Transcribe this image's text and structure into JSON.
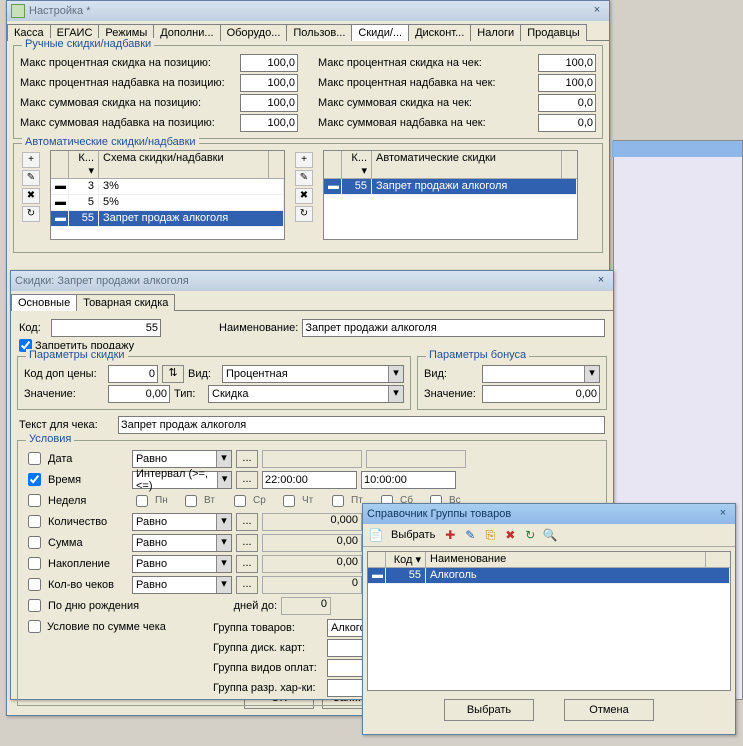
{
  "bg": {},
  "win1": {
    "title": "Настройка *",
    "tabs": [
      "Касса",
      "ЕГАИС",
      "Режимы",
      "Дополни...",
      "Оборудо...",
      "Пользов...",
      "Скиди/...",
      "Дисконт...",
      "Налоги",
      "Продавцы"
    ],
    "active_tab": 6,
    "g1": {
      "legend": "Ручные скидки/надбавки",
      "rows_left": [
        {
          "lbl": "Макс процентная скидка на позицию:",
          "val": "100,0"
        },
        {
          "lbl": "Макс процентная надбавка на позицию:",
          "val": "100,0"
        },
        {
          "lbl": "Макс суммовая скидка на позицию:",
          "val": "100,0"
        },
        {
          "lbl": "Макс суммовая надбавка на позицию:",
          "val": "100,0"
        }
      ],
      "rows_right": [
        {
          "lbl": "Макс процентная скидка на чек:",
          "val": "100,0"
        },
        {
          "lbl": "Макс процентная надбавка на чек:",
          "val": "100,0"
        },
        {
          "lbl": "Макс суммовая скидка на чек:",
          "val": "0,0"
        },
        {
          "lbl": "Макс суммовая надбавка на чек:",
          "val": "0,0"
        }
      ]
    },
    "g2": {
      "legend": "Автоматические скидки/надбавки",
      "left": {
        "head": [
          "",
          "К...",
          "Схема скидки/надбавки"
        ],
        "rows": [
          {
            "k": "3",
            "name": "3%"
          },
          {
            "k": "5",
            "name": "5%"
          },
          {
            "k": "55",
            "name": "Запрет продаж алкоголя"
          }
        ],
        "sel": 2
      },
      "right": {
        "head": [
          "",
          "К...",
          "Автоматические скидки"
        ],
        "rows": [
          {
            "k": "55",
            "name": "Запрет продажи алкоголя"
          }
        ],
        "sel": 0
      }
    },
    "buttons": {
      "ok": "OK",
      "save": "Зап..."
    }
  },
  "win2": {
    "title": "Скидки: Запрет продажи алкоголя",
    "tabs": [
      "Основные",
      "Товарная скидка"
    ],
    "active_tab": 0,
    "code_lbl": "Код:",
    "code": "55",
    "name_lbl": "Наименование:",
    "name": "Запрет продажи алкоголя",
    "forbid": "Запретить продажу",
    "forbid_checked": true,
    "p_skidka": {
      "legend": "Параметры скидки",
      "dopcode_lbl": "Код доп цены:",
      "dopcode": "0",
      "vid_lbl": "Вид:",
      "vid": "Процентная",
      "val_lbl": "Значение:",
      "val": "0,00",
      "tip_lbl": "Тип:",
      "tip": "Скидка"
    },
    "p_bonus": {
      "legend": "Параметры бонуса",
      "vid_lbl": "Вид:",
      "vid": "",
      "val_lbl": "Значение:",
      "val": "0,00"
    },
    "textchek_lbl": "Текст для чека:",
    "textchek": "Запрет продаж алкоголя",
    "cond": {
      "legend": "Условия",
      "rows": [
        {
          "cb": false,
          "lbl": "Дата",
          "op": "Равно"
        },
        {
          "cb": true,
          "lbl": "Время",
          "op": "Интервал (>=,<=)",
          "v1": "22:00:00",
          "v2": "10:00:00"
        },
        {
          "cb": false,
          "lbl": "Неделя",
          "days": [
            "Пн",
            "Вт",
            "Ср",
            "Чт",
            "Пт",
            "Сб",
            "Вс"
          ]
        },
        {
          "cb": false,
          "lbl": "Количество",
          "op": "Равно",
          "val": "0,000"
        },
        {
          "cb": false,
          "lbl": "Сумма",
          "op": "Равно",
          "val": "0,00"
        },
        {
          "cb": false,
          "lbl": "Накопление",
          "op": "Равно",
          "val": "0,00"
        },
        {
          "cb": false,
          "lbl": "Кол-во чеков",
          "op": "Равно",
          "val": "0"
        }
      ],
      "birthday_lbl": "По дню рождения",
      "days_lbl": "дней до:",
      "days_val": "0",
      "sumchek_lbl": "Условие по сумме чека",
      "gt_lbl": "Группа товаров:",
      "gt_val": "Алкоголь",
      "gdk_lbl": "Группа диск. карт:",
      "gvo_lbl": "Группа видов оплат:",
      "grh_lbl": "Группа разр. хар-ки:"
    }
  },
  "win3": {
    "title": "Справочник Группы товаров",
    "select_btn": "Выбрать",
    "grid": {
      "head": [
        "",
        "Код",
        "Наименование"
      ],
      "rows": [
        {
          "k": "55",
          "name": "Алкоголь"
        }
      ],
      "sel": 0
    },
    "btn_select": "Выбрать",
    "btn_cancel": "Отмена"
  }
}
